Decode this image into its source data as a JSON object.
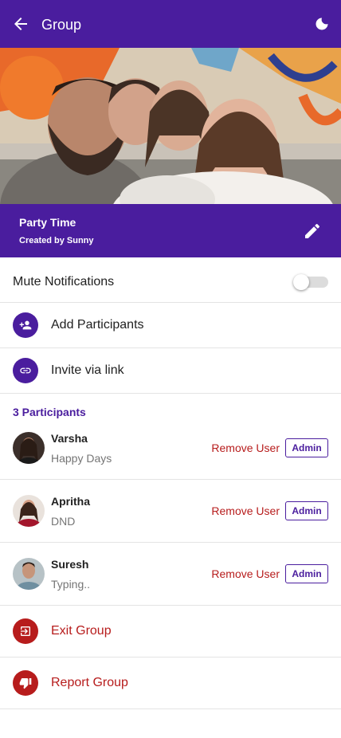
{
  "appbar": {
    "title": "Group",
    "back_icon": "arrow-back-icon",
    "theme_icon": "moon-icon"
  },
  "group": {
    "name": "Party Time",
    "created_by": "Created by Sunny",
    "edit_icon": "pencil-icon"
  },
  "settings": {
    "mute_label": "Mute Notifications",
    "mute_enabled": false,
    "add_participants_label": "Add Participants",
    "add_participants_icon": "person-add-icon",
    "invite_label": "Invite via link",
    "invite_icon": "link-icon"
  },
  "participants": {
    "count_label": "3 Participants",
    "items": [
      {
        "name": "Varsha",
        "status": "Happy Days",
        "remove_label": "Remove User",
        "role": "Admin"
      },
      {
        "name": "Apritha",
        "status": "DND",
        "remove_label": "Remove User",
        "role": "Admin"
      },
      {
        "name": "Suresh",
        "status": "Typing..",
        "remove_label": "Remove User",
        "role": "Admin"
      }
    ]
  },
  "actions": {
    "exit_label": "Exit Group",
    "exit_icon": "exit-icon",
    "report_label": "Report Group",
    "report_icon": "thumb-down-icon"
  },
  "colors": {
    "primary": "#4a1d9e",
    "danger": "#b71c1c",
    "divider": "#e4e4e4"
  }
}
